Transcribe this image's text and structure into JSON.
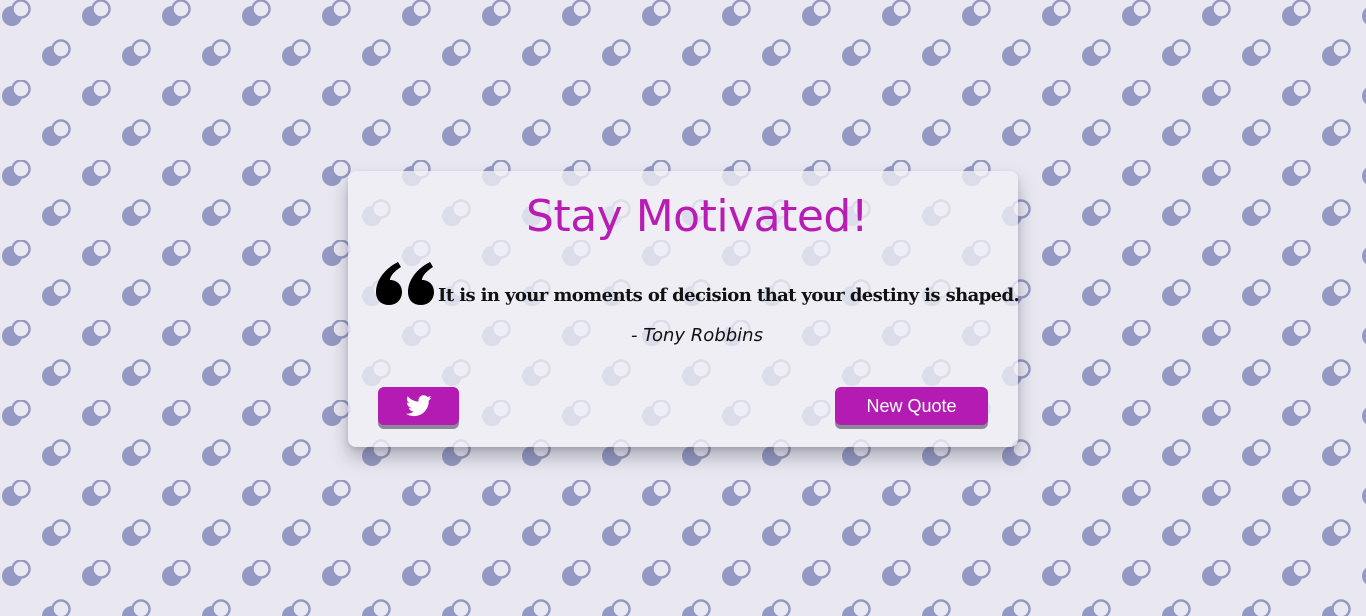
{
  "card": {
    "title": "Stay Motivated!",
    "quote": "It is in your moments of decision that your destiny is shaped.",
    "author": "- Tony Robbins"
  },
  "buttons": {
    "tweet_icon": "twitter-icon",
    "new_quote_label": "New Quote"
  },
  "colors": {
    "accent": "#b81cb4",
    "background": "#e9e8f1",
    "pattern": "#9499c3"
  }
}
